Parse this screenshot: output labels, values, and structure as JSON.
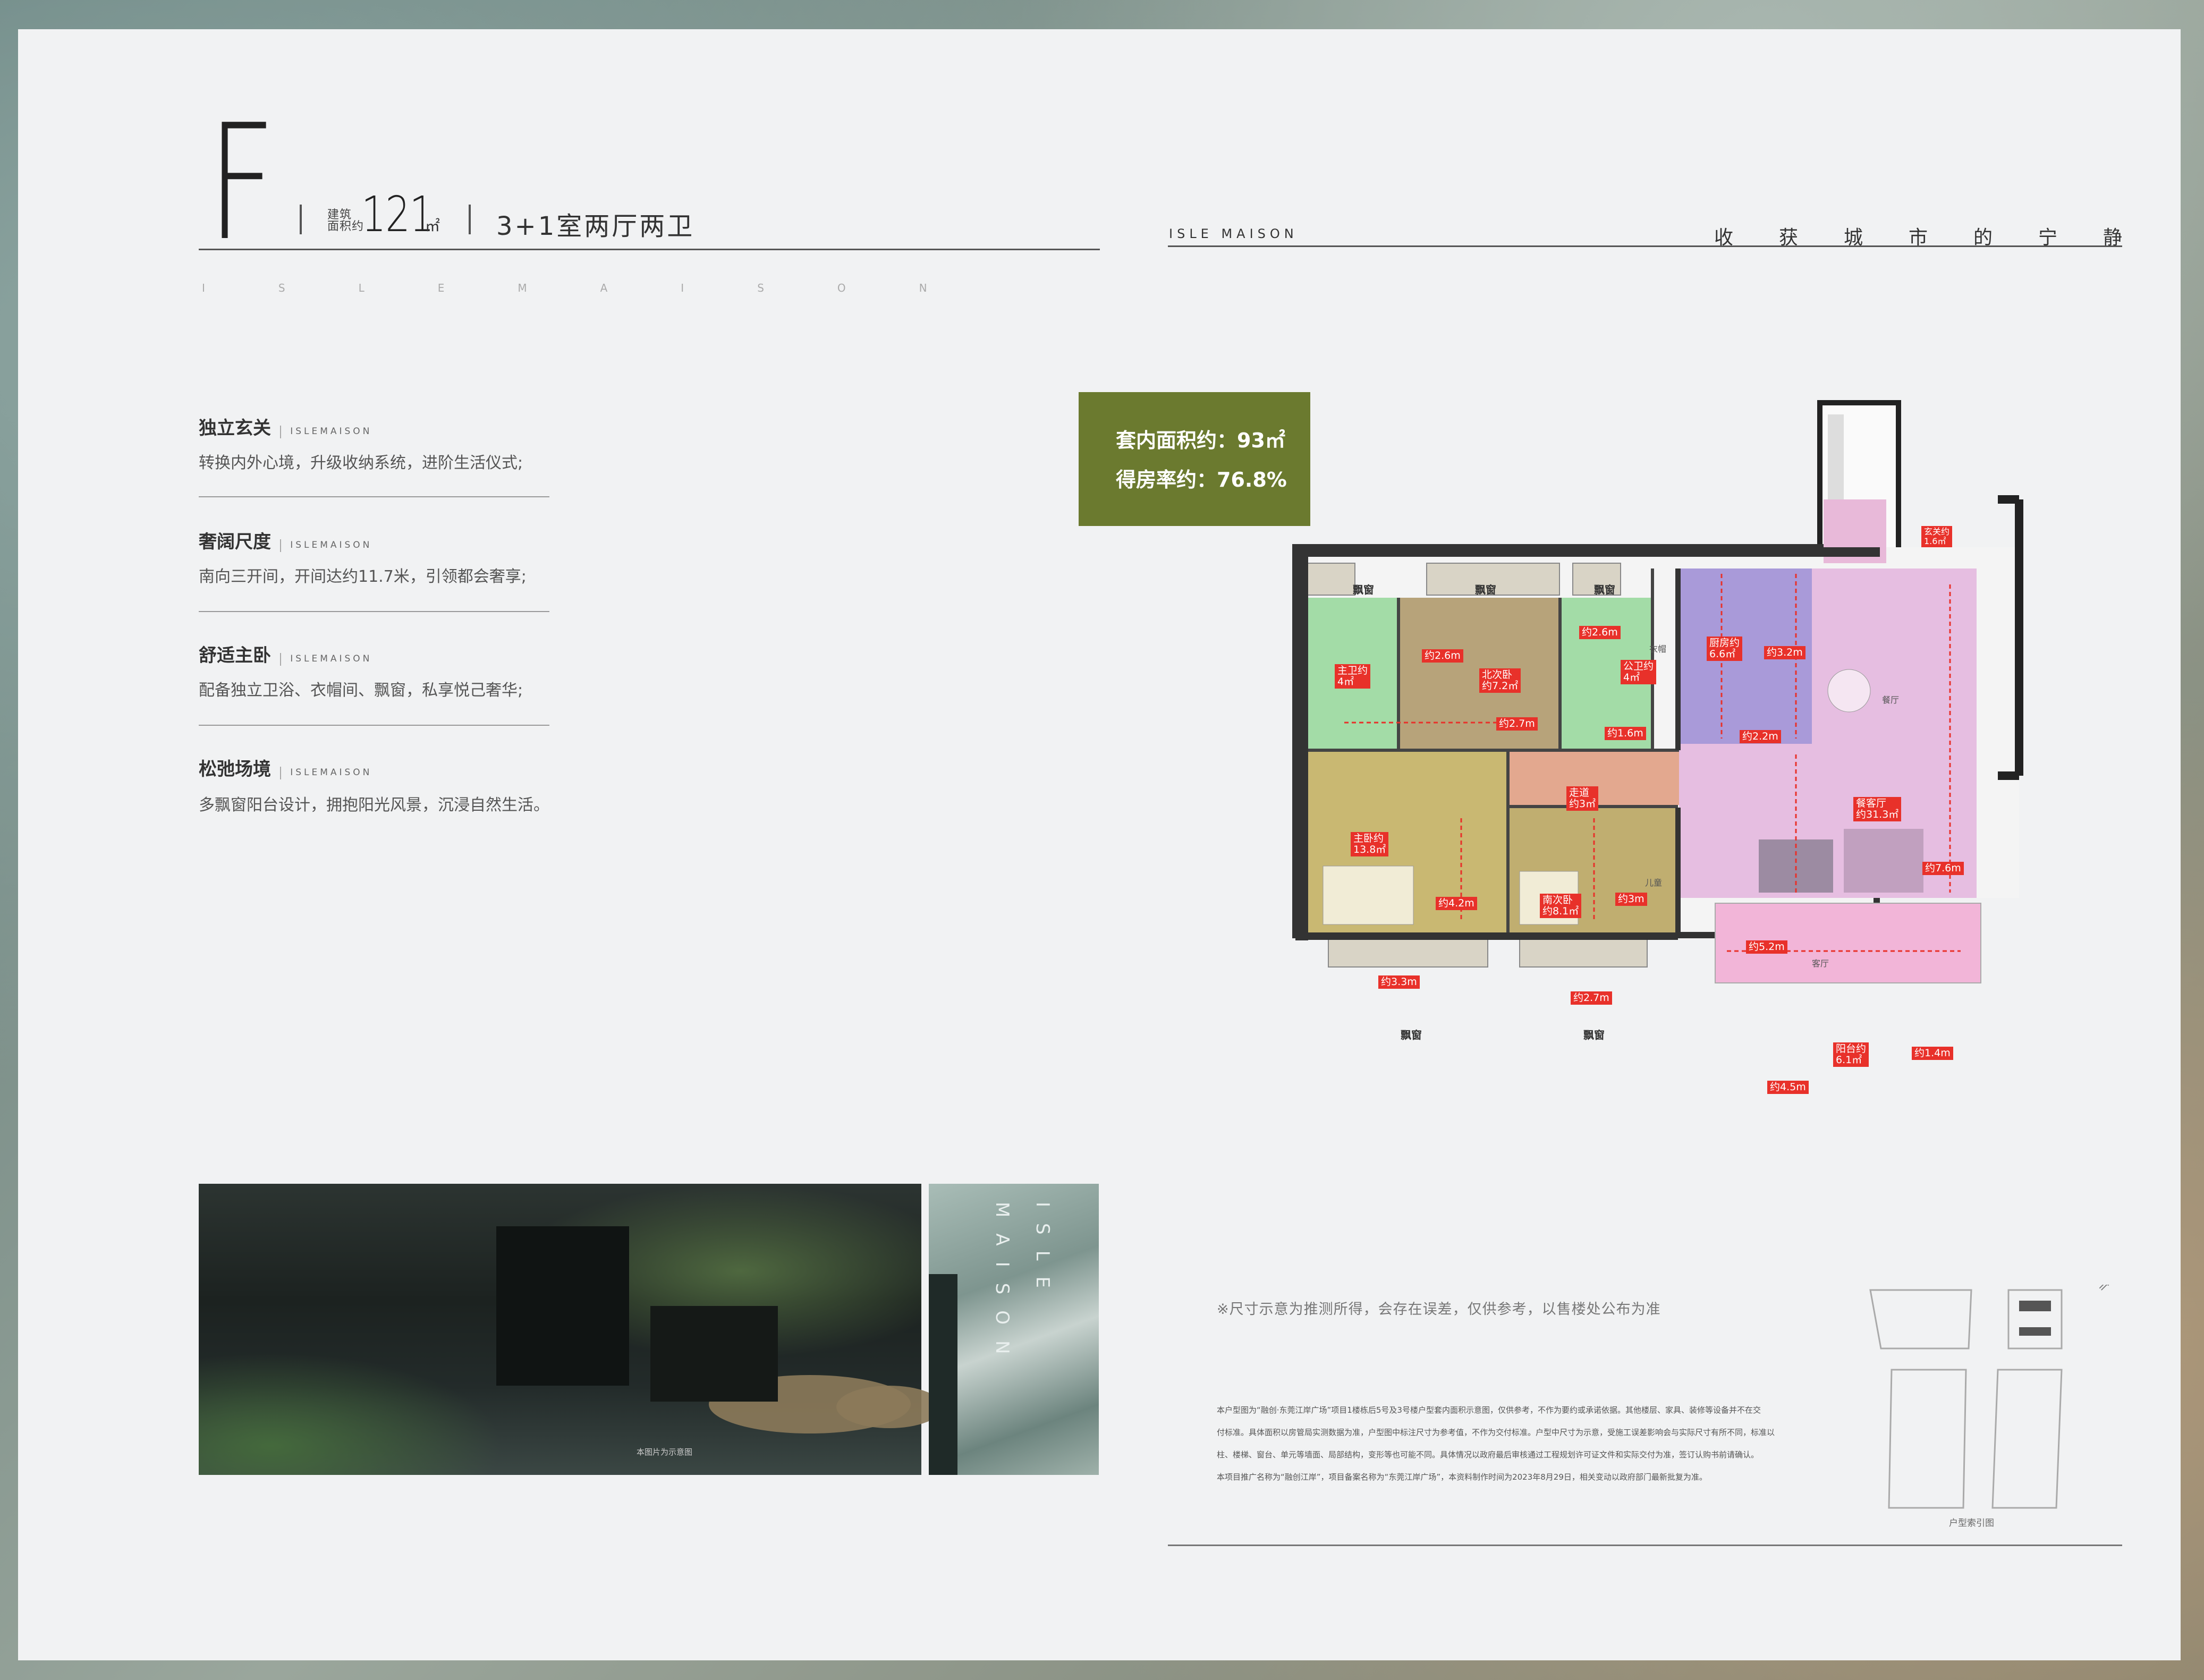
{
  "header": {
    "unit_letter": "F",
    "area_label_1": "建筑",
    "area_label_2": "面积约",
    "area_value": "121",
    "area_unit": "㎡",
    "room_type": "3+1室两厅两卫",
    "spaced_brand": "ISLEMAISON",
    "brand_right": "ISLE MAISON",
    "slogan": "收获城市的宁静"
  },
  "features": [
    {
      "title": "独立玄关",
      "sub": "ISLEMAISON",
      "desc": "转换内外心境，升级收纳系统，进阶生活仪式;"
    },
    {
      "title": "奢阔尺度",
      "sub": "ISLEMAISON",
      "desc": "南向三开间，开间达约11.7米，引领都会奢享;"
    },
    {
      "title": "舒适主卧",
      "sub": "ISLEMAISON",
      "desc": "配备独立卫浴、衣帽间、飘窗，私享悦己奢华;"
    },
    {
      "title": "松弛场境",
      "sub": "ISLEMAISON",
      "desc": "多飘窗阳台设计，拥抱阳光风景，沉浸自然生活。"
    }
  ],
  "summary": {
    "inner_area": "套内面积约：93㎡",
    "efficiency": "得房率约：76.8%"
  },
  "photo": {
    "caption": "本图片为示意图",
    "vertical_word_1": "ISLE",
    "vertical_word_2": "MAISON"
  },
  "plan": {
    "window_label": "飘窗",
    "ensuite_bath": "主卫约\n4㎡",
    "north_bedroom": "北次卧\n约7.2㎡",
    "public_bath": "公卫约\n4㎡",
    "kitchen": "厨房约\n6.6㎡",
    "entrance": "玄关约\n1.6㎡",
    "corridor": "走道\n约3㎡",
    "dining_living": "餐客厅\n约31.3㎡",
    "master_bedroom": "主卧约\n13.8㎡",
    "south_bedroom": "南次卧\n约8.1㎡",
    "balcony": "阳台约\n6.1㎡",
    "dims": {
      "d1": "约2.6m",
      "d2": "约2.6m",
      "d3": "约2.7m",
      "d4": "约1.6m",
      "d5": "约3.2m",
      "d6": "约2.2m",
      "d7": "约4.2m",
      "d8": "约3.3m",
      "d9": "约3m",
      "d10": "约2.7m",
      "d11": "约7.6m",
      "d12": "约5.2m",
      "d13": "约1.4m",
      "d14": "约4.5m"
    },
    "small_labels": {
      "wardrobe": "衣帽",
      "dining": "餐厅",
      "living": "客厅",
      "nursery": "儿童"
    }
  },
  "note": "※尺寸示意为推测所得，会存在误差，仅供参考，以售楼处公布为准",
  "disclaimer": [
    "本户型图为“融创·东莞江岸广场”项目1楼栋后5号及3号楼户型套内面积示意图，仅供参考，不作为要约或承诺依据。其他楼层、家具、装修等设备并不在交",
    "付标准。具体面积以房管局实测数据为准，户型图中标注尺寸为参考值，不作为交付标准。户型中尺寸为示意，受施工误差影响会与实际尺寸有所不同，标准以",
    "柱、楼梯、窗台、单元等墙面、局部结构，变形等也可能不同。具体情况以政府最后审核通过工程规划许可证文件和实际交付为准，签订认购书前请确认。",
    "本项目推广名称为“融创江岸”，项目备案名称为“东莞江岸广场”，本资料制作时间为2023年8月29日，相关变动以政府部门最新批复为准。"
  ],
  "mini_plan_caption": "户型索引图"
}
